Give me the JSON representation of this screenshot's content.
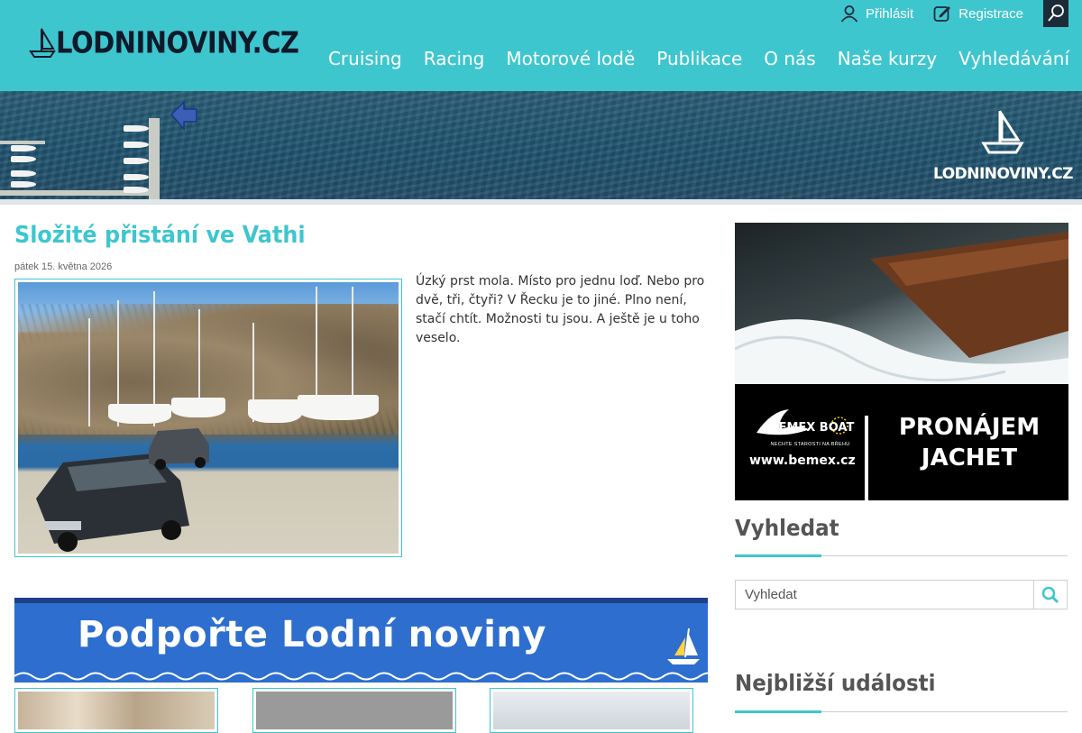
{
  "site": {
    "logo_text": "LODNINOVINY.CZ",
    "brand_color": "#3ec6cf",
    "dark_color": "#1c2b3a"
  },
  "topbar": {
    "login_label": "Přihlásit",
    "register_label": "Registrace",
    "login_icon": "user-icon",
    "register_icon": "edit-icon",
    "search_icon": "search-icon"
  },
  "nav": {
    "items": [
      {
        "label": "Cruising"
      },
      {
        "label": "Racing"
      },
      {
        "label": "Motorové lodě"
      },
      {
        "label": "Publikace"
      },
      {
        "label": "O nás"
      },
      {
        "label": "Naše kurzy"
      },
      {
        "label": "Vyhledávání"
      }
    ]
  },
  "banner": {
    "logo_text": "LODNINOVINY.CZ"
  },
  "article": {
    "title": "Složité přistání ve Vathi",
    "date": "pátek 15. května 2026",
    "excerpt": "Úzký prst mola. Místo pro jednu loď. Nebo pro dvě, tři, čtyři? V Řecku je to jiné. Plno není, stačí chtít. Možnosti tu jsou. A ještě je u toho veselo."
  },
  "support_banner": {
    "text": "Podpořte Lodní noviny"
  },
  "ad": {
    "brand": "BEMEX BOAT",
    "tagline": "NECHTE STAROSTI NA BŘEHU",
    "website": "www.bemex.cz",
    "cta_line1": "PRONÁJEM",
    "cta_line2": "JACHET"
  },
  "sidebar": {
    "search_heading": "Vyhledat",
    "search_placeholder": "Vyhledat",
    "events_heading": "Nejbližší události"
  }
}
